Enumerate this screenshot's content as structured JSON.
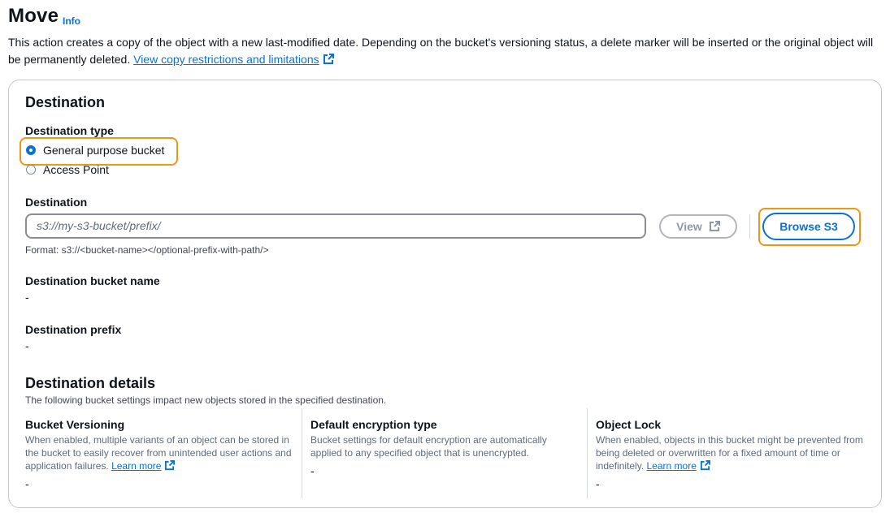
{
  "header": {
    "title": "Move",
    "info_label": "Info",
    "description": "This action creates a copy of the object with a new last-modified date. Depending on the bucket's versioning status, a delete marker will be inserted or the original object will be permanently deleted.",
    "restrictions_link": "View copy restrictions and limitations"
  },
  "destination": {
    "heading": "Destination",
    "type_label": "Destination type",
    "options": [
      {
        "label": "General purpose bucket",
        "checked": true
      },
      {
        "label": "Access Point",
        "checked": false
      }
    ],
    "field_label": "Destination",
    "input_value": "",
    "input_placeholder": "s3://my-s3-bucket/prefix/",
    "view_button": "View",
    "browse_button": "Browse S3",
    "format_hint": "Format: s3://<bucket-name></optional-prefix-with-path/>",
    "bucket_name_label": "Destination bucket name",
    "bucket_name_value": "-",
    "prefix_label": "Destination prefix",
    "prefix_value": "-"
  },
  "details": {
    "heading": "Destination details",
    "subtitle": "The following bucket settings impact new objects stored in the specified destination.",
    "columns": [
      {
        "title": "Bucket Versioning",
        "description": "When enabled, multiple variants of an object can be stored in the bucket to easily recover from unintended user actions and application failures.",
        "link": "Learn more",
        "value": "-"
      },
      {
        "title": "Default encryption type",
        "description": "Bucket settings for default encryption are automatically applied to any specified object that is unencrypted.",
        "link": "",
        "value": "-"
      },
      {
        "title": "Object Lock",
        "description": "When enabled, objects in this bucket might be prevented from being deleted or overwritten for a fixed amount of time or indefinitely.",
        "link": "Learn more",
        "value": "-"
      }
    ]
  },
  "colors": {
    "accent": "#0972d3",
    "highlight": "#ec9812",
    "border": "#c6c6cd"
  },
  "icons": {
    "external_link": "external-link-icon"
  }
}
